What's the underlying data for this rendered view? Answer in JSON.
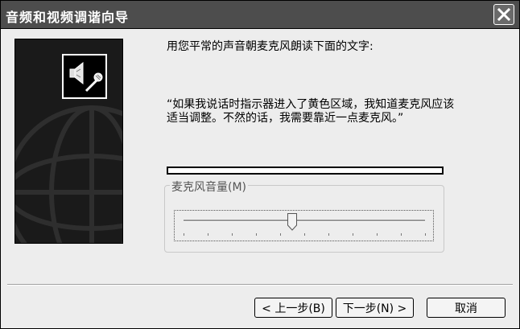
{
  "window": {
    "title": "音频和视频调谐向导"
  },
  "page": {
    "instruction": "用您平常的声音朝麦克风朗读下面的文字:",
    "quote": "“如果我说话时指示器进入了黄色区域，我知道麦克风应该适当调整。不然的话，我需要靠近一点麦克风。”"
  },
  "level_meter": {
    "level": 0
  },
  "volume": {
    "label": "麦克风音量(M)",
    "value_fraction": 0.45
  },
  "buttons": {
    "back": "< 上一步(B)",
    "next": "下一步(N) >",
    "cancel": "取消"
  },
  "icons": {
    "close": "close-icon",
    "speaker_mic": "speaker-microphone-icon"
  }
}
